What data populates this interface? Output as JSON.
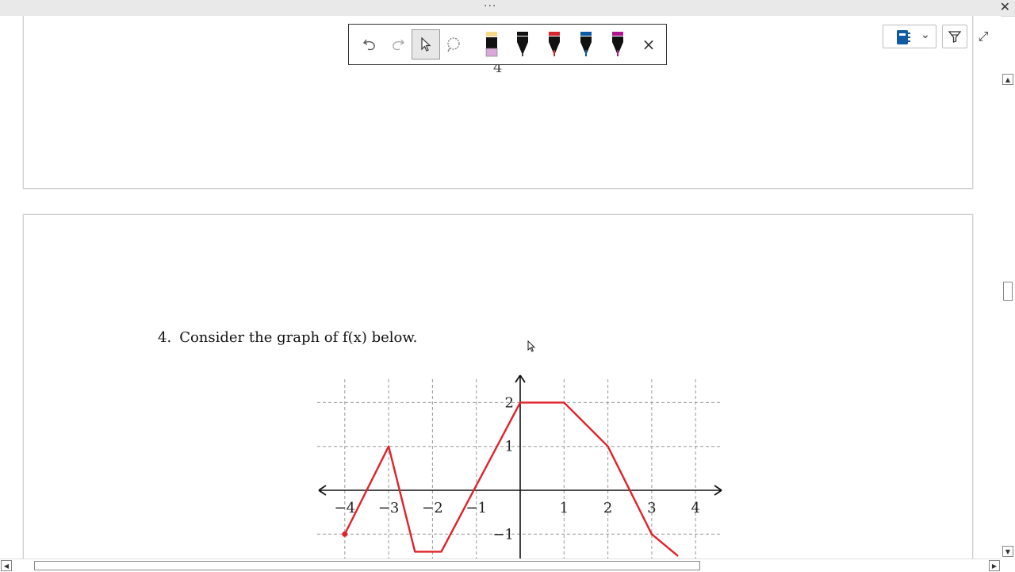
{
  "window": {
    "title_dots": "···",
    "close_glyph": "✕"
  },
  "page_number": "4",
  "question": {
    "number": "4.",
    "text": "Consider the graph of f(x) below."
  },
  "ink_toolbar": {
    "tools": [
      {
        "name": "undo-icon"
      },
      {
        "name": "redo-icon"
      },
      {
        "name": "select-pointer-icon",
        "selected": true
      },
      {
        "name": "lasso-icon"
      },
      {
        "name": "highlighter-icon",
        "color": "#f5d98b"
      },
      {
        "name": "pen-black-icon",
        "color": "#111111"
      },
      {
        "name": "pen-red-icon",
        "color": "#d9242c"
      },
      {
        "name": "pen-blue-icon",
        "color": "#0c5aa6"
      },
      {
        "name": "pen-magenta-icon",
        "color": "#b0168d"
      }
    ],
    "close_glyph": "×"
  },
  "right_tools": {
    "notebook_icon": "notebook-icon",
    "dropdown_glyph": "⌄",
    "expand_glyph": "⤢"
  },
  "chart_data": {
    "type": "line",
    "title": "",
    "xlabel": "",
    "ylabel": "",
    "xlim": [
      -4,
      4
    ],
    "ylim": [
      -1,
      2
    ],
    "grid": true,
    "x_ticks": [
      "−4",
      "−3",
      "−2",
      "−1",
      "1",
      "2",
      "3",
      "4"
    ],
    "y_ticks": [
      "2",
      "1",
      "−1"
    ],
    "series": [
      {
        "color": "#e0222a",
        "points": [
          [
            -4,
            -1
          ],
          [
            -3,
            1
          ],
          [
            -2.4,
            -1.4
          ],
          [
            -1.8,
            -1.4
          ],
          [
            0,
            2
          ],
          [
            1,
            2
          ],
          [
            2,
            1
          ],
          [
            3,
            -1
          ],
          [
            3.6,
            -1.5
          ]
        ],
        "start_dot": [
          -4,
          -1
        ]
      }
    ]
  }
}
